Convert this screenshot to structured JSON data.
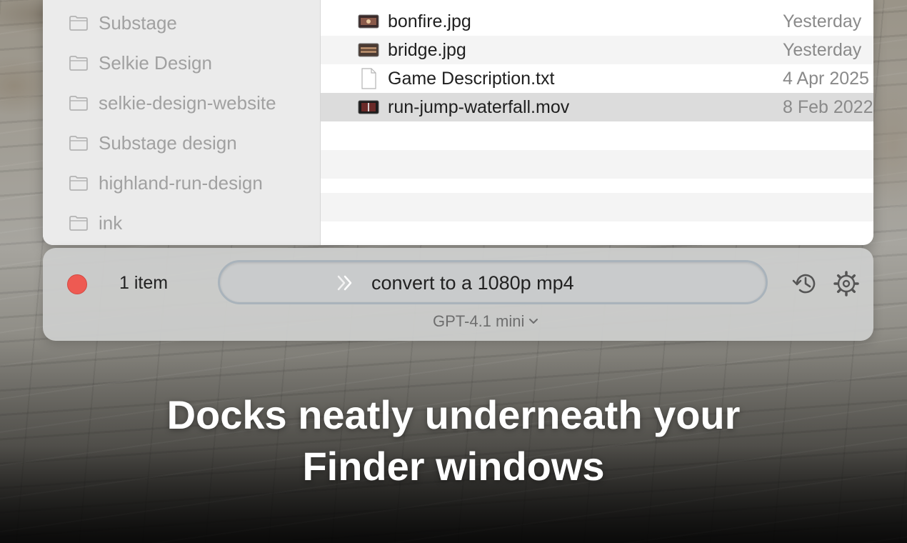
{
  "sidebar": {
    "items": [
      {
        "label": "Substage",
        "icon": "folder-icon"
      },
      {
        "label": "Selkie Design",
        "icon": "folder-icon"
      },
      {
        "label": "selkie-design-website",
        "icon": "folder-icon"
      },
      {
        "label": "Substage design",
        "icon": "folder-icon"
      },
      {
        "label": "highland-run-design",
        "icon": "folder-icon"
      },
      {
        "label": "ink",
        "icon": "folder-icon"
      }
    ]
  },
  "files": [
    {
      "name": "bonfire.jpg",
      "date": "Yesterday",
      "icon": "image-thumbnail-icon"
    },
    {
      "name": "bridge.jpg",
      "date": "Yesterday",
      "icon": "image-thumbnail-icon"
    },
    {
      "name": "Game Description.txt",
      "date": "4 Apr 2025",
      "icon": "text-document-icon"
    },
    {
      "name": "run-jump-waterfall.mov",
      "date": "8 Feb 2022",
      "icon": "video-thumbnail-icon",
      "selected": true
    }
  ],
  "command_bar": {
    "item_count": "1 item",
    "prompt_text": "convert to a 1080p mp4",
    "model": "GPT-4.1 mini",
    "icons": [
      "close-dot",
      "chevrons-right-icon",
      "history-icon",
      "gear-icon",
      "chevron-down-icon"
    ],
    "colors": {
      "close": "#ee5a52",
      "prompt_border": "#a9b3bb"
    }
  },
  "caption": {
    "line1": "Docks neatly underneath your",
    "line2": "Finder windows"
  }
}
